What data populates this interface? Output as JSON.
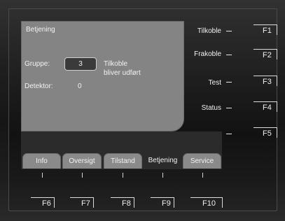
{
  "panel": {
    "title": "Betjening",
    "gruppe_label": "Gruppe:",
    "gruppe_value": "3",
    "status_line1": "Tilkoble",
    "status_line2": "bliver udført",
    "detektor_label": "Detektor:",
    "detektor_value": "0"
  },
  "tabs": [
    {
      "label": "Info"
    },
    {
      "label": "Oversigt"
    },
    {
      "label": "Tilstand"
    },
    {
      "label": "Betjening",
      "active": true
    },
    {
      "label": "Service"
    }
  ],
  "side_menu": [
    {
      "label": "Tilkoble",
      "key": "F1"
    },
    {
      "label": "Frakoble",
      "key": "F2"
    },
    {
      "label": "Test",
      "key": "F3"
    },
    {
      "label": "Status",
      "key": "F4"
    },
    {
      "label": "",
      "key": "F5"
    }
  ],
  "bottom_keys": [
    "F6",
    "F7",
    "F8",
    "F9",
    "F10"
  ]
}
